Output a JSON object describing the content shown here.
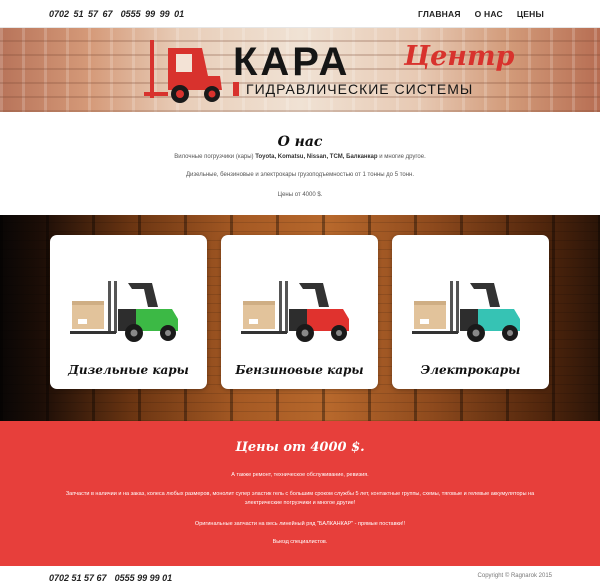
{
  "header": {
    "phones": [
      "0702 51 57 67",
      "0555 99 99 01"
    ],
    "nav": [
      "ГЛАВНАЯ",
      "О НАС",
      "ЦЕНЫ"
    ]
  },
  "hero": {
    "logo_title": "КАРА",
    "logo_script": "Центр",
    "logo_subtitle": "ГИДРАВЛИЧЕСКИЕ СИСТЕМЫ",
    "accent_color": "#d8322d"
  },
  "about": {
    "title": "О нас",
    "line1_start": "Вилочные погрузчики (кары)",
    "line1_brands": "Toyota, Komatsu, Nissan, TCM, Балканкар",
    "line1_end": "и многие другое.",
    "line2": "Дизельные, бензиновые и электрокары грузоподъемностью от 1 тонны до 5 тонн.",
    "line3": "Цены от 4000 $."
  },
  "cards": [
    {
      "label": "Дизельные кары",
      "icon": "forklift-icon",
      "color": "#3cb945"
    },
    {
      "label": "Бензиновые кары",
      "icon": "forklift-icon",
      "color": "#e0322e"
    },
    {
      "label": "Электрокары",
      "icon": "forklift-icon",
      "color": "#36c3b4"
    }
  ],
  "prices": {
    "title": "Цены от 4000 $.",
    "line1": "А также ремонт, техническое обслуживание, ревизия.",
    "line2": "Запчасти в наличии и на заказ, колеса любых размеров, монолит супер эластик гель с большим сроком службы 5 лет, контактные группы, схемы, тяговые и гелевые аккумуляторы на электрические погрузчики и многое другие!",
    "line3": "Оригинальные запчасти на весь линейный ряд \"БАЛКАНКАР\" - прямые поставки!!",
    "line4": "Выезд специалистов.",
    "background": "#e73f3b"
  },
  "footer": {
    "phones": [
      "0702 51 57 67",
      "0555 99 99 01"
    ],
    "copyright": "Copyright © Ragnarok 2015"
  }
}
